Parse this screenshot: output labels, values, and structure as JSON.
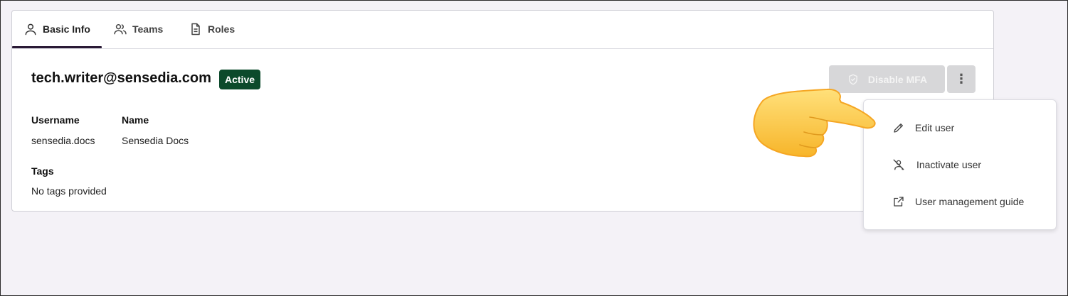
{
  "tabs": [
    {
      "label": "Basic Info",
      "icon": "user-icon",
      "active": true
    },
    {
      "label": "Teams",
      "icon": "users-icon",
      "active": false
    },
    {
      "label": "Roles",
      "icon": "document-icon",
      "active": false
    }
  ],
  "user": {
    "email": "tech.writer@sensedia.com",
    "status": "Active",
    "status_color": "#0c4a2b"
  },
  "fields": {
    "username_label": "Username",
    "username_value": "sensedia.docs",
    "name_label": "Name",
    "name_value": "Sensedia Docs",
    "tags_label": "Tags",
    "tags_value": "No tags provided"
  },
  "actions": {
    "disable_mfa_label": "Disable MFA",
    "more_label": "⋮"
  },
  "menu": {
    "items": [
      {
        "label": "Edit user",
        "icon": "pencil-icon"
      },
      {
        "label": "Inactivate user",
        "icon": "user-off-icon"
      },
      {
        "label": "User management guide",
        "icon": "external-link-icon"
      }
    ]
  },
  "colors": {
    "accent": "#2a1a35",
    "background": "#f4f2f7",
    "pointer_hand": "#ffcc3d"
  }
}
